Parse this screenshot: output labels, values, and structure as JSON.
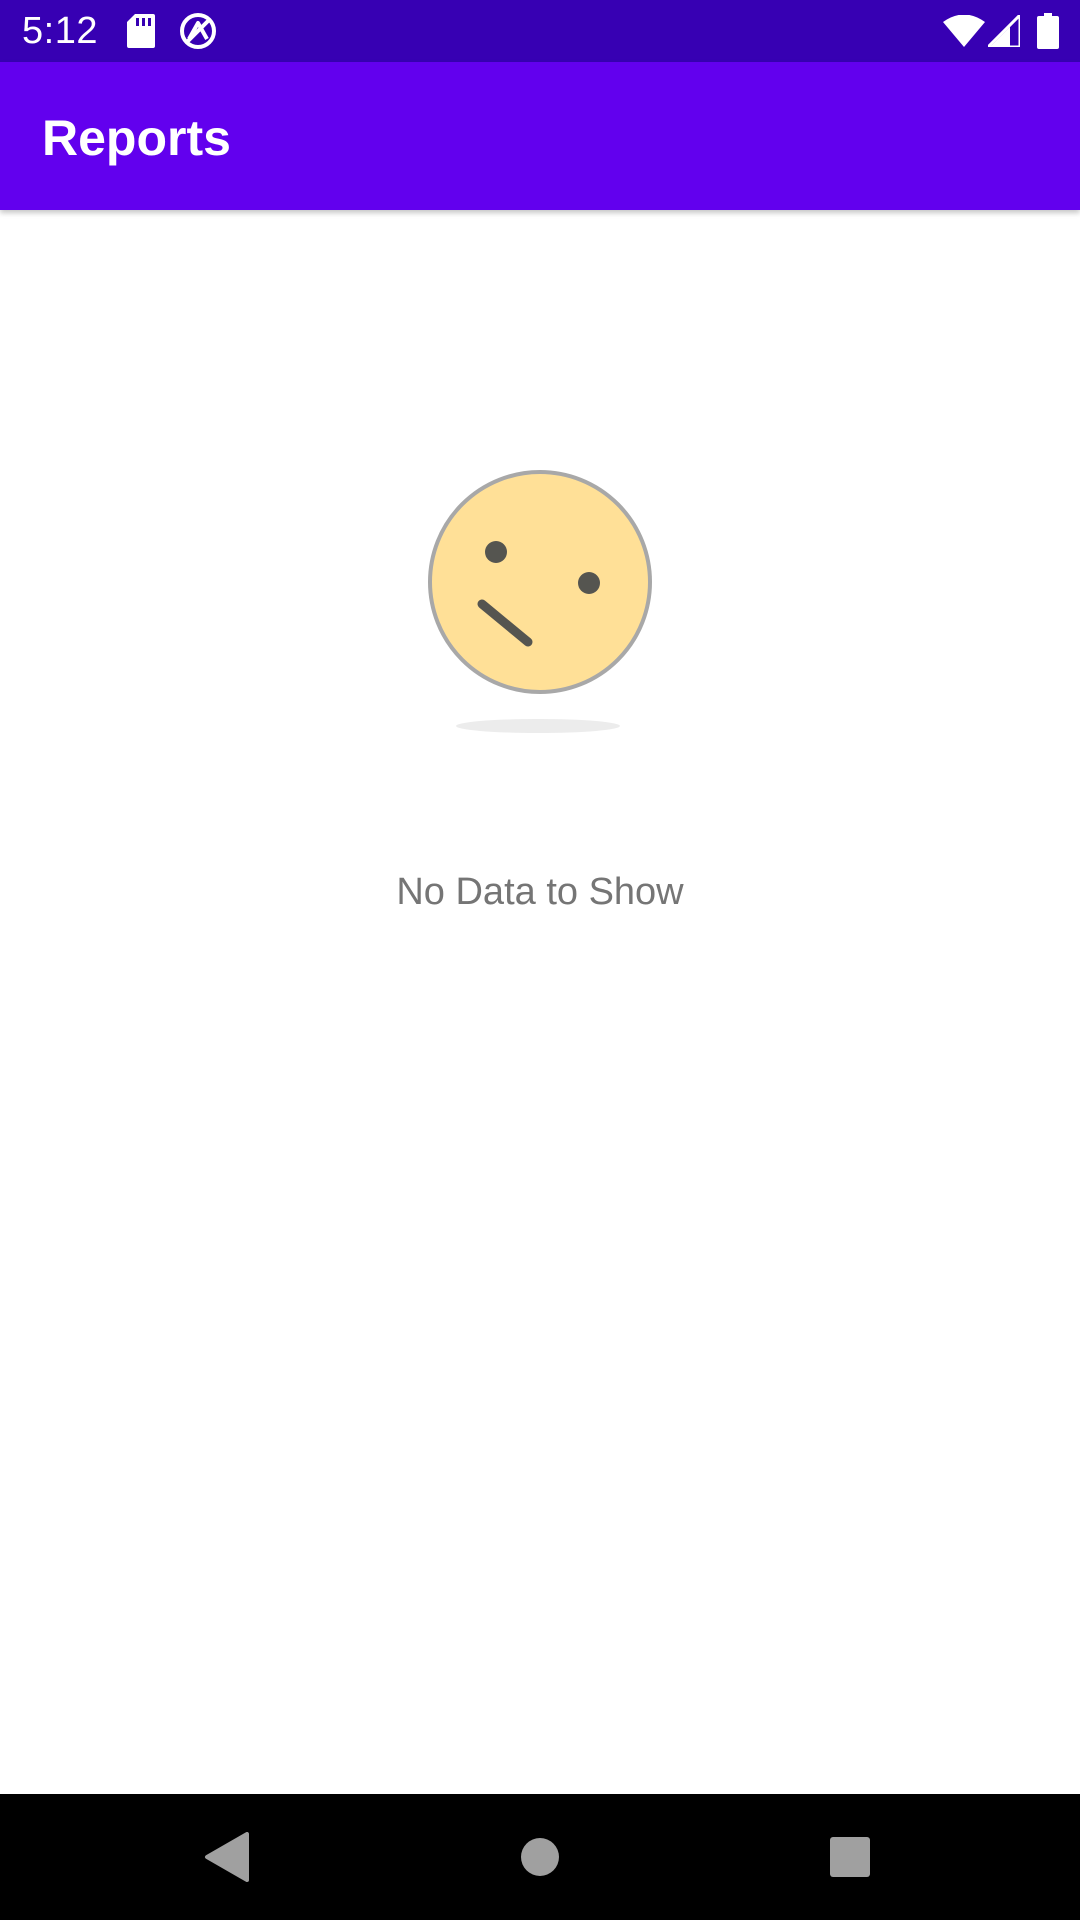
{
  "status_bar": {
    "time": "5:12",
    "left_icons": [
      "sd-card-icon",
      "data-saver-icon"
    ],
    "right_icons": [
      "wifi-icon",
      "cell-signal-icon",
      "battery-icon"
    ],
    "color": "#3700b3"
  },
  "app_bar": {
    "title": "Reports",
    "color": "#6200ee"
  },
  "empty_state": {
    "illustration": "confused-face-icon",
    "message": "No Data to Show",
    "face_color": "#ffe097"
  },
  "nav_bar": {
    "buttons": [
      "back-icon",
      "home-icon",
      "recents-icon"
    ]
  }
}
